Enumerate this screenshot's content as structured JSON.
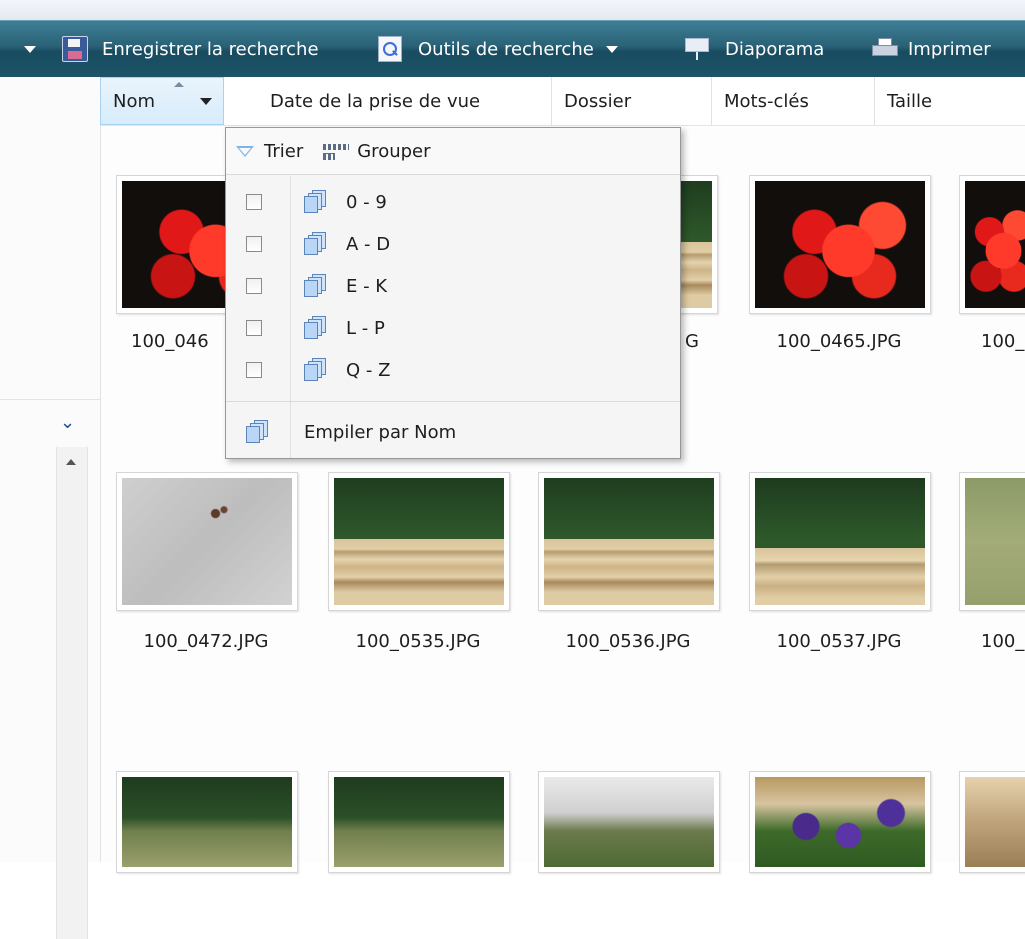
{
  "toolbar": {
    "save_search_label": "Enregistrer la recherche",
    "search_tools_label": "Outils de recherche",
    "slideshow_label": "Diaporama",
    "print_label": "Imprimer"
  },
  "columns": {
    "name": "Nom",
    "date_taken": "Date de la prise de vue",
    "folder": "Dossier",
    "tags": "Mots-clés",
    "size": "Taille"
  },
  "menu": {
    "sort_label": "Trier",
    "group_label": "Grouper",
    "filters": [
      "0 - 9",
      "A - D",
      "E - K",
      "L - P",
      "Q - Z"
    ],
    "stack_label": "Empiler par Nom"
  },
  "files": {
    "row1": [
      "100_046",
      "G",
      "100_0465.JPG",
      "100_"
    ],
    "row2": [
      "100_0472.JPG",
      "100_0535.JPG",
      "100_0536.JPG",
      "100_0537.JPG",
      "100_"
    ]
  },
  "icons": [
    "dropdown-arrow-icon",
    "save-search-icon",
    "search-tools-icon",
    "slideshow-icon",
    "print-icon",
    "sort-triangle-icon",
    "group-icon",
    "checkbox-icon",
    "stack-icon",
    "chevron-down-icon",
    "scroll-up-icon"
  ]
}
